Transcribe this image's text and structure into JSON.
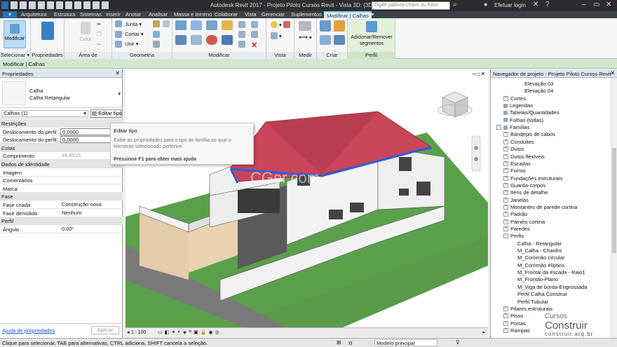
{
  "titlebar": {
    "title": "Autodesk Revit 2017 -   Projeto Piloto Cursos Revit - Vista 3D: {3D}",
    "search_placeholder": "Digite palavra-chave ou frase",
    "login": "Efetuar login"
  },
  "tabs": [
    "Arquitetura",
    "Estrutura",
    "Sistemas",
    "Inserir",
    "Anotar",
    "Analisar",
    "Massa e terreno",
    "Colaborar",
    "Vista",
    "Gerenciar",
    "Suplementos",
    "Modificar | Calhas"
  ],
  "ribbon": {
    "modify": "Modificar",
    "color": "Color",
    "junta": "Junta",
    "cortar": "Cortar",
    "unir": "Unir",
    "add_remove": "Adicionar/Remover segmentos",
    "panels": [
      "Selecionar",
      "Propriedades",
      "Área de transferência",
      "Geometria",
      "Modificar",
      "Vista",
      "Medir",
      "Criar",
      "Perfil"
    ]
  },
  "context_bar": "Modificar | Calhas",
  "properties": {
    "header": "Propriedades",
    "type_family": "Calha",
    "type_name": "Calha Retangular",
    "instance_selector": "Calhas (1)",
    "edit_type": "Editar tipo",
    "rows": [
      {
        "kind": "section",
        "label": "Restrições"
      },
      {
        "kind": "field",
        "label": "Deslocamento do perfil ...",
        "value": "0,0000"
      },
      {
        "kind": "field",
        "label": "Deslocamento do perfil ...",
        "value": "0,0000"
      },
      {
        "kind": "section",
        "label": "Cotas"
      },
      {
        "kind": "field",
        "label": "Comprimento",
        "value": "49,8515"
      },
      {
        "kind": "section",
        "label": "Dados de identidade"
      },
      {
        "kind": "field",
        "label": "Imagem",
        "value": ""
      },
      {
        "kind": "field",
        "label": "Comentários",
        "value": ""
      },
      {
        "kind": "field",
        "label": "Marca",
        "value": ""
      },
      {
        "kind": "section",
        "label": "Fase"
      },
      {
        "kind": "field",
        "label": "Fase criada",
        "value": "Construção nova"
      },
      {
        "kind": "field",
        "label": "Fase demolida",
        "value": "Nenhum"
      },
      {
        "kind": "section",
        "label": "Perfil"
      },
      {
        "kind": "field",
        "label": "Ângulo",
        "value": "0,00°"
      }
    ],
    "help_link": "Ajuda de propriedades",
    "apply": "Aplicar"
  },
  "tooltip": {
    "title": "Editar tipo",
    "body": "Exibe as propriedades para o tipo de família ao qual o elemento selecionado pertence.",
    "hint": "Pressione F1 para obter mais ajuda"
  },
  "viewport": {
    "watermark": "CGer.com",
    "scale": "1 : 100",
    "cube_label": "SUPERIOR",
    "colors": {
      "roof": "#c9455a",
      "gutter": "#2e5fd8",
      "grass": "#5aa04a",
      "wall": "#f2f2f2"
    }
  },
  "browser": {
    "header": "Navegador de projeto - Projeto Piloto Cursos Revit",
    "items": [
      {
        "label": "Elevação 03",
        "level": 3,
        "exp": ""
      },
      {
        "label": "Elevação 04",
        "level": 3,
        "exp": ""
      },
      {
        "label": "Cortes",
        "level": 1,
        "exp": "+"
      },
      {
        "label": "Legendas",
        "level": 0,
        "exp": "",
        "icon": true
      },
      {
        "label": "Tabelas/Quantidades",
        "level": 0,
        "exp": "",
        "icon": true
      },
      {
        "label": "Folhas (todas)",
        "level": 0,
        "exp": "",
        "icon": true
      },
      {
        "label": "Famílias",
        "level": 0,
        "exp": "−",
        "icon": true
      },
      {
        "label": "Bandejas de cabos",
        "level": 1,
        "exp": "+"
      },
      {
        "label": "Conduites",
        "level": 1,
        "exp": "+"
      },
      {
        "label": "Dutos",
        "level": 1,
        "exp": "+"
      },
      {
        "label": "Dutos flexíveis",
        "level": 1,
        "exp": "+"
      },
      {
        "label": "Escadas",
        "level": 1,
        "exp": "+"
      },
      {
        "label": "Forros",
        "level": 1,
        "exp": "+"
      },
      {
        "label": "Fundações estruturais",
        "level": 1,
        "exp": "+"
      },
      {
        "label": "Guarda-corpos",
        "level": 1,
        "exp": "+"
      },
      {
        "label": "Itens de detalhe",
        "level": 1,
        "exp": "+"
      },
      {
        "label": "Janelas",
        "level": 1,
        "exp": "+"
      },
      {
        "label": "Montantes de parede cortina",
        "level": 1,
        "exp": "+"
      },
      {
        "label": "Padrão",
        "level": 1,
        "exp": "+"
      },
      {
        "label": "Painéis cortina",
        "level": 1,
        "exp": "+"
      },
      {
        "label": "Paredes",
        "level": 1,
        "exp": "+"
      },
      {
        "label": "Perfis",
        "level": 1,
        "exp": "−"
      },
      {
        "label": "Calha - Retangular",
        "level": 2,
        "exp": ""
      },
      {
        "label": "M_Calha - Chanfro",
        "level": 2,
        "exp": ""
      },
      {
        "label": "M_Corrimão circular",
        "level": 2,
        "exp": ""
      },
      {
        "label": "M_Corrimão elíptico",
        "level": 2,
        "exp": ""
      },
      {
        "label": "M_Frontal da escada - Raio1",
        "level": 2,
        "exp": ""
      },
      {
        "label": "M_Frontão-Plano",
        "level": 2,
        "exp": ""
      },
      {
        "label": "M_Viga de borda-Engrossada",
        "level": 2,
        "exp": ""
      },
      {
        "label": "Perfil Calha Construir",
        "level": 2,
        "exp": ""
      },
      {
        "label": "Perfil Tubular",
        "level": 2,
        "exp": ""
      },
      {
        "label": "Pilares estruturais",
        "level": 1,
        "exp": "+"
      },
      {
        "label": "Pisos",
        "level": 1,
        "exp": "+"
      },
      {
        "label": "Portas",
        "level": 1,
        "exp": "+"
      },
      {
        "label": "Rampas",
        "level": 1,
        "exp": "+"
      }
    ]
  },
  "status": {
    "text": "Clique para selecionar, TAB para alternativas, CTRL adiciona, SHIFT cancela a seleção.",
    "model": "Modelo principal",
    "zero": ":0"
  },
  "brand": {
    "line1": "Cursos",
    "line2": "Construir",
    "line3": "construir.arq.br"
  }
}
